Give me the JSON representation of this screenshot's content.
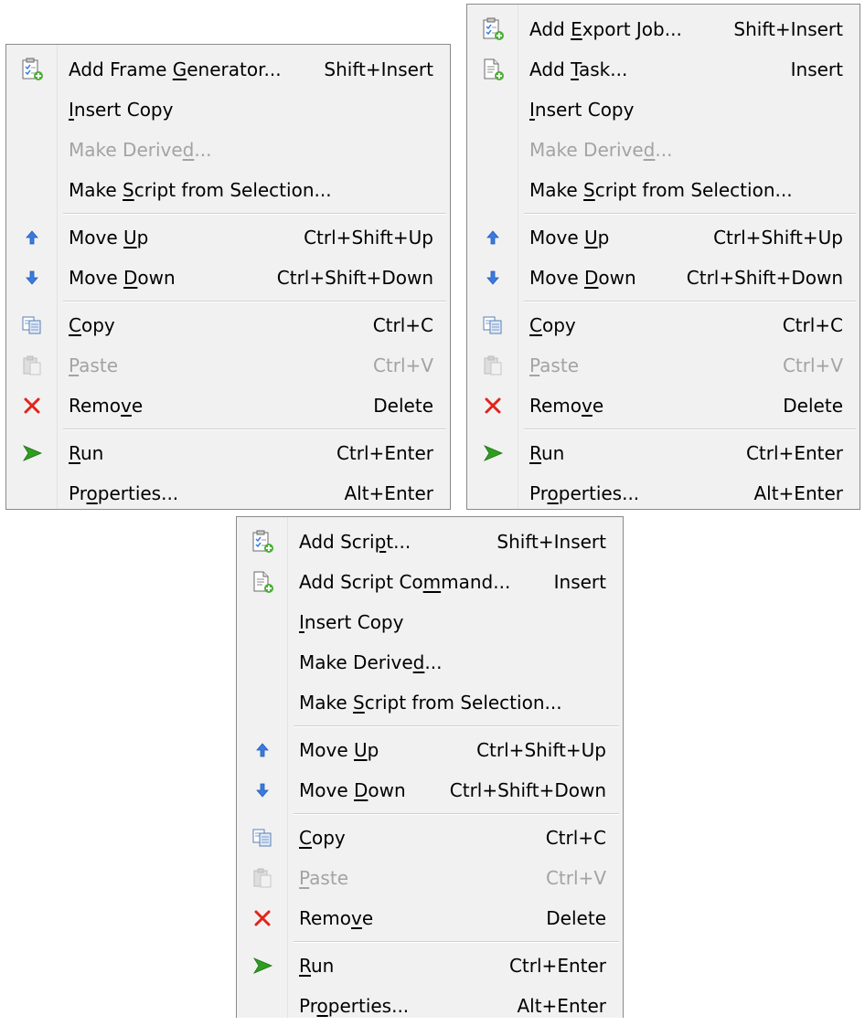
{
  "menu1": {
    "items": [
      {
        "pre": "Add Frame ",
        "u": "G",
        "post": "enerator...",
        "shortcut": "Shift+Insert"
      },
      {
        "pre": "",
        "u": "I",
        "post": "nsert Copy",
        "shortcut": ""
      },
      {
        "pre": "Make Derive",
        "u": "d",
        "post": "...",
        "shortcut": ""
      },
      {
        "pre": "Make ",
        "u": "S",
        "post": "cript from Selection...",
        "shortcut": ""
      },
      {
        "pre": "Move ",
        "u": "U",
        "post": "p",
        "shortcut": "Ctrl+Shift+Up"
      },
      {
        "pre": "Move ",
        "u": "D",
        "post": "own",
        "shortcut": "Ctrl+Shift+Down"
      },
      {
        "pre": "",
        "u": "C",
        "post": "opy",
        "shortcut": "Ctrl+C"
      },
      {
        "pre": "",
        "u": "P",
        "post": "aste",
        "shortcut": "Ctrl+V"
      },
      {
        "pre": "Remo",
        "u": "v",
        "post": "e",
        "shortcut": "Delete"
      },
      {
        "pre": "",
        "u": "R",
        "post": "un",
        "shortcut": "Ctrl+Enter"
      },
      {
        "pre": "Pr",
        "u": "o",
        "post": "perties...",
        "shortcut": "Alt+Enter"
      }
    ]
  },
  "menu2": {
    "items": [
      {
        "pre": "Add ",
        "u": "E",
        "post": "xport Job...",
        "shortcut": "Shift+Insert"
      },
      {
        "pre": "Add ",
        "u": "T",
        "post": "ask...",
        "shortcut": "Insert"
      },
      {
        "pre": "",
        "u": "I",
        "post": "nsert Copy",
        "shortcut": ""
      },
      {
        "pre": "Make Derive",
        "u": "d",
        "post": "...",
        "shortcut": ""
      },
      {
        "pre": "Make ",
        "u": "S",
        "post": "cript from Selection...",
        "shortcut": ""
      },
      {
        "pre": "Move ",
        "u": "U",
        "post": "p",
        "shortcut": "Ctrl+Shift+Up"
      },
      {
        "pre": "Move ",
        "u": "D",
        "post": "own",
        "shortcut": "Ctrl+Shift+Down"
      },
      {
        "pre": "",
        "u": "C",
        "post": "opy",
        "shortcut": "Ctrl+C"
      },
      {
        "pre": "",
        "u": "P",
        "post": "aste",
        "shortcut": "Ctrl+V"
      },
      {
        "pre": "Remo",
        "u": "v",
        "post": "e",
        "shortcut": "Delete"
      },
      {
        "pre": "",
        "u": "R",
        "post": "un",
        "shortcut": "Ctrl+Enter"
      },
      {
        "pre": "Pr",
        "u": "o",
        "post": "perties...",
        "shortcut": "Alt+Enter"
      }
    ]
  },
  "menu3": {
    "items": [
      {
        "pre": "Add Scri",
        "u": "p",
        "post": "t...",
        "shortcut": "Shift+Insert"
      },
      {
        "pre": "Add Script Co",
        "u": "m",
        "post": "mand...",
        "shortcut": "Insert"
      },
      {
        "pre": "",
        "u": "I",
        "post": "nsert Copy",
        "shortcut": ""
      },
      {
        "pre": "Make Derive",
        "u": "d",
        "post": "...",
        "shortcut": ""
      },
      {
        "pre": "Make ",
        "u": "S",
        "post": "cript from Selection...",
        "shortcut": ""
      },
      {
        "pre": "Move ",
        "u": "U",
        "post": "p",
        "shortcut": "Ctrl+Shift+Up"
      },
      {
        "pre": "Move ",
        "u": "D",
        "post": "own",
        "shortcut": "Ctrl+Shift+Down"
      },
      {
        "pre": "",
        "u": "C",
        "post": "opy",
        "shortcut": "Ctrl+C"
      },
      {
        "pre": "",
        "u": "P",
        "post": "aste",
        "shortcut": "Ctrl+V"
      },
      {
        "pre": "Remo",
        "u": "v",
        "post": "e",
        "shortcut": "Delete"
      },
      {
        "pre": "",
        "u": "R",
        "post": "un",
        "shortcut": "Ctrl+Enter"
      },
      {
        "pre": "Pr",
        "u": "o",
        "post": "perties...",
        "shortcut": "Alt+Enter"
      }
    ]
  },
  "icons": {
    "add-generator": "clipboard-add-icon",
    "add-task": "document-add-icon",
    "move-up": "arrow-up-icon",
    "move-down": "arrow-down-icon",
    "copy": "copy-icon",
    "paste": "paste-icon",
    "remove": "remove-x-icon",
    "run": "run-play-icon"
  },
  "colors": {
    "menu_bg": "#f1f1f1",
    "border": "#8a8a8a",
    "disabled_text": "#a3a3a3",
    "arrow_blue": "#3b7be0",
    "remove_red": "#e0241b",
    "run_green": "#2e9e1f"
  }
}
